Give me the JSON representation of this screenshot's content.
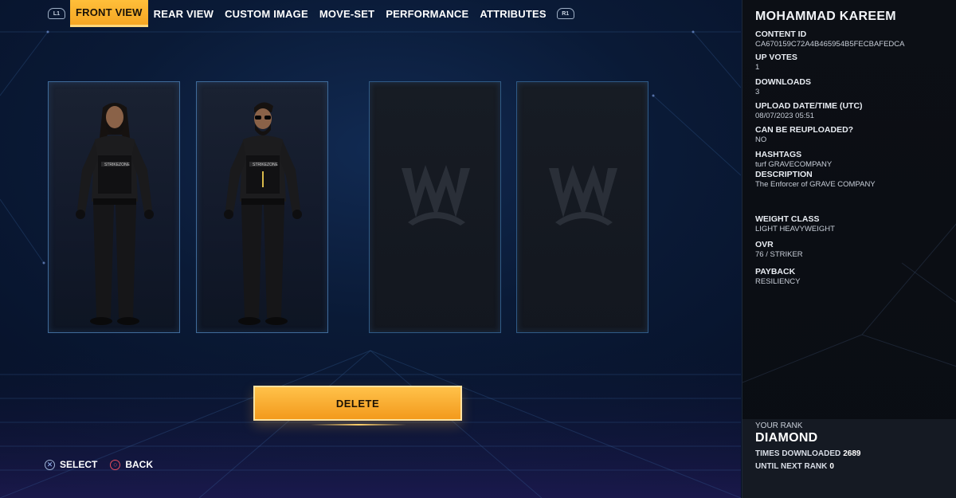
{
  "tabs": {
    "left_bumper": "L1",
    "right_bumper": "R1",
    "items": [
      {
        "label": "FRONT VIEW",
        "active": true
      },
      {
        "label": "REAR VIEW",
        "active": false
      },
      {
        "label": "CUSTOM IMAGE",
        "active": false
      },
      {
        "label": "MOVE-SET",
        "active": false
      },
      {
        "label": "PERFORMANCE",
        "active": false
      },
      {
        "label": "ATTRIBUTES",
        "active": false
      }
    ]
  },
  "slots": [
    {
      "state": "filled",
      "character": "Long hair, full beard, black tactical vest"
    },
    {
      "state": "filled",
      "character": "Slicked hair, sunglasses, black tactical vest"
    },
    {
      "state": "empty",
      "placeholder_icon": "wwe-logo-icon"
    },
    {
      "state": "empty",
      "placeholder_icon": "wwe-logo-icon"
    }
  ],
  "actions": {
    "delete_label": "DELETE"
  },
  "prompts": {
    "select_label": "SELECT",
    "back_label": "BACK"
  },
  "details": {
    "name": "MOHAMMAD KAREEM",
    "content_id_label": "CONTENT ID",
    "content_id": "CA670159C72A4B465954B5FECBAFEDCA",
    "up_votes_label": "UP VOTES",
    "up_votes": "1",
    "downloads_label": "DOWNLOADS",
    "downloads": "3",
    "upload_label": "UPLOAD DATE/TIME (UTC)",
    "upload": "08/07/2023 05:51",
    "reupload_label": "CAN BE REUPLOADED?",
    "reupload": "NO",
    "hashtags_label": "HASHTAGS",
    "hashtags": "turf GRAVECOMPANY",
    "description_label": "DESCRIPTION",
    "description": "The Enforcer of GRAVE COMPANY",
    "weight_class_label": "WEIGHT CLASS",
    "weight_class": "LIGHT HEAVYWEIGHT",
    "ovr_label": "OVR",
    "ovr": "76 / STRIKER",
    "payback_label": "PAYBACK",
    "payback": "RESILIENCY"
  },
  "rank": {
    "your_rank_label": "YOUR RANK",
    "your_rank": "DIAMOND",
    "times_downloaded_label": "TIMES DOWNLOADED",
    "times_downloaded": "2689",
    "until_next_label": "UNTIL NEXT RANK",
    "until_next": "0"
  },
  "colors": {
    "accent": "#f5a623",
    "background": "#0a1a36",
    "panel": "#0c0f15"
  }
}
